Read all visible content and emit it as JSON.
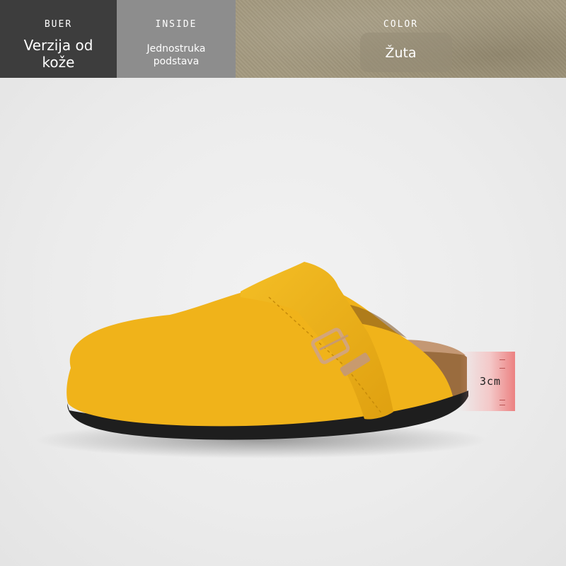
{
  "header": {
    "outer": {
      "label": "BUER",
      "value_lines": [
        "Verzija od",
        "kože"
      ]
    },
    "inner": {
      "label": "INSIDE",
      "value_lines": [
        "Jednostruka",
        "podstava"
      ]
    },
    "color": {
      "label": "COLOR",
      "value": "Žuta"
    }
  },
  "product": {
    "upper_color": "#f0b31a",
    "sole_color": "#1e1e1e",
    "cork_color": "#9a6c3e",
    "height_label": "3cm"
  }
}
